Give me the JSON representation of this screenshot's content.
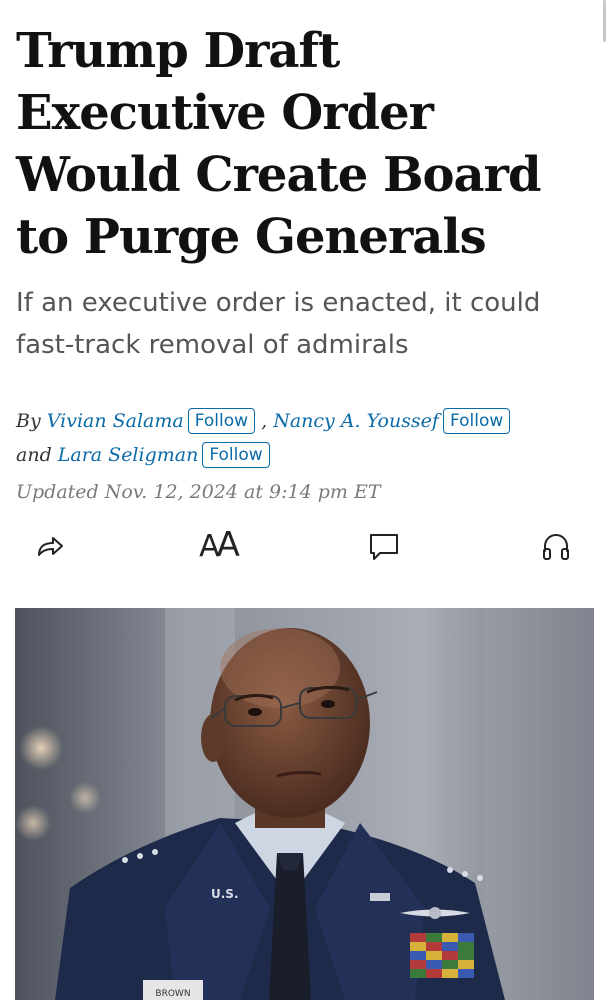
{
  "article": {
    "headline": "Trump Draft Executive Order Would Create Board to Purge Generals",
    "dek": "If an executive order is enacted, it could fast-track removal of admirals",
    "byline": {
      "by": "By",
      "and": "and",
      "comma": ",",
      "authors": [
        {
          "name": "Vivian Salama",
          "follow_label": "Follow"
        },
        {
          "name": "Nancy A. Youssef",
          "follow_label": "Follow"
        },
        {
          "name": "Lara Seligman",
          "follow_label": "Follow"
        }
      ]
    },
    "timestamp": "Updated Nov. 12, 2024 at 9:14 pm ET"
  },
  "toolbar": {
    "items": [
      {
        "icon": "share-icon"
      },
      {
        "icon": "text-size-icon",
        "glyph": "AA"
      },
      {
        "icon": "comment-icon"
      },
      {
        "icon": "headphones-icon"
      }
    ]
  },
  "hero_image": {
    "uniform_text_us": "U.S.",
    "name_tag": "BROWN"
  },
  "colors": {
    "link": "#0b6aa8",
    "headline": "#111111",
    "dek": "#555555",
    "timestamp": "#7a7a7a"
  }
}
